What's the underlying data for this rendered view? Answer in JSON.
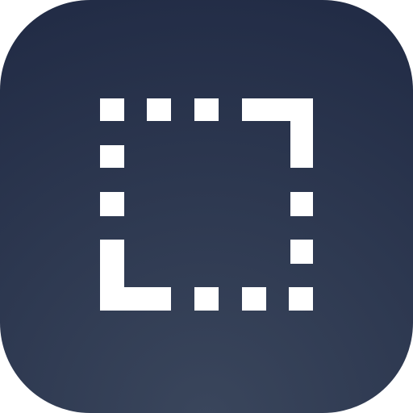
{
  "app_icon": {
    "icon": "selection-frame-icon",
    "colors": {
      "background_top": "#212b45",
      "background_bottom": "#3a465c",
      "glyph": "#ffffff"
    }
  }
}
